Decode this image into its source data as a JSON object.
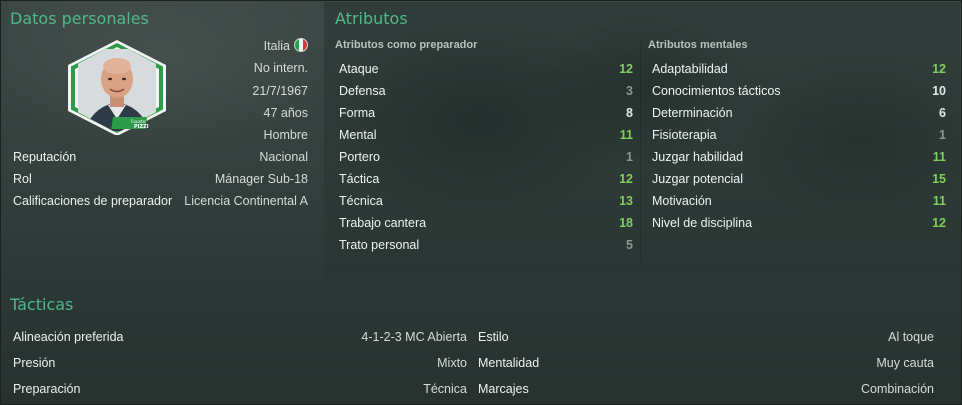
{
  "personal": {
    "title": "Datos personales",
    "badge_name": "Fausto PIZZI",
    "nationality": "Italia",
    "nat_status": "No intern.",
    "dob": "21/7/1967",
    "age": "47 años",
    "gender": "Hombre",
    "rows": [
      {
        "k": "Reputación",
        "v": "Nacional"
      },
      {
        "k": "Rol",
        "v": "Mánager Sub-18"
      },
      {
        "k": "Calificaciones de preparador",
        "v": "Licencia Continental A"
      }
    ]
  },
  "attributes": {
    "title": "Atributos",
    "coaching_header": "Atributos como preparador",
    "mental_header": "Atributos mentales",
    "coaching": [
      {
        "name": "Ataque",
        "value": "12"
      },
      {
        "name": "Defensa",
        "value": "3"
      },
      {
        "name": "Forma",
        "value": "8"
      },
      {
        "name": "Mental",
        "value": "11"
      },
      {
        "name": "Portero",
        "value": "1"
      },
      {
        "name": "Táctica",
        "value": "12"
      },
      {
        "name": "Técnica",
        "value": "13"
      },
      {
        "name": "Trabajo cantera",
        "value": "18"
      },
      {
        "name": "Trato personal",
        "value": "5"
      }
    ],
    "mental": [
      {
        "name": "Adaptabilidad",
        "value": "12"
      },
      {
        "name": "Conocimientos tácticos",
        "value": "10"
      },
      {
        "name": "Determinación",
        "value": "6"
      },
      {
        "name": "Fisioterapia",
        "value": "1"
      },
      {
        "name": "Juzgar habilidad",
        "value": "11"
      },
      {
        "name": "Juzgar potencial",
        "value": "15"
      },
      {
        "name": "Motivación",
        "value": "11"
      },
      {
        "name": "Nivel de disciplina",
        "value": "12"
      }
    ]
  },
  "tactics": {
    "title": "Tácticas",
    "rows": [
      [
        {
          "k": "Alineación preferida",
          "v": "4-1-2-3 MC Abierta"
        },
        {
          "k": "Estilo",
          "v": "Al toque"
        }
      ],
      [
        {
          "k": "Presión",
          "v": "Mixto"
        },
        {
          "k": "Mentalidad",
          "v": "Muy cauta"
        }
      ],
      [
        {
          "k": "Preparación",
          "v": "Técnica"
        },
        {
          "k": "Marcajes",
          "v": "Combinación"
        }
      ]
    ]
  },
  "colors": {
    "accent_title": "#4fb88a",
    "value_high": "#7fcf5c",
    "value_mid": "#e4e8e7",
    "value_low": "#8c9593"
  }
}
